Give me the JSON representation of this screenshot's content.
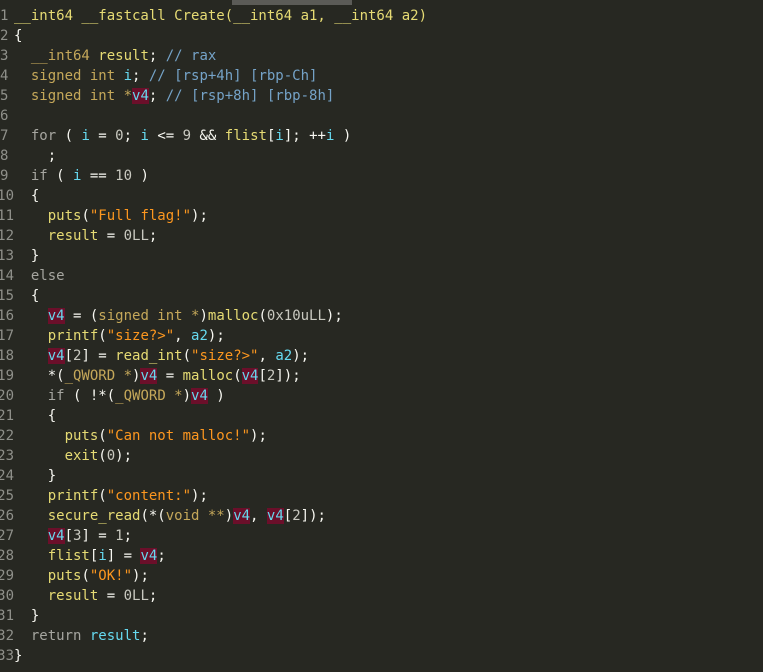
{
  "window": {
    "scroll_fraction": 0.33
  },
  "code": {
    "lines": [
      {
        "n": "1",
        "tokens": [
          {
            "t": "__int64 __fastcall Create(__int64 a1, __int64 a2)",
            "c": "fn"
          }
        ]
      },
      {
        "n": "2",
        "tokens": [
          {
            "t": "{",
            "c": "op"
          }
        ]
      },
      {
        "n": "3",
        "tokens": [
          {
            "t": "  __int64 ",
            "c": "ty"
          },
          {
            "t": "result",
            "c": "fn"
          },
          {
            "t": "; ",
            "c": "op"
          },
          {
            "t": "// rax",
            "c": "cm"
          }
        ]
      },
      {
        "n": "4",
        "tokens": [
          {
            "t": "  signed int ",
            "c": "ty"
          },
          {
            "t": "i",
            "c": "var"
          },
          {
            "t": "; ",
            "c": "op"
          },
          {
            "t": "// [rsp+4h] [rbp-Ch]",
            "c": "cm"
          }
        ]
      },
      {
        "n": "5",
        "tokens": [
          {
            "t": "  signed int *",
            "c": "ty"
          },
          {
            "t": "v4",
            "c": "hl"
          },
          {
            "t": "; ",
            "c": "op"
          },
          {
            "t": "// [rsp+8h] [rbp-8h]",
            "c": "cm"
          }
        ]
      },
      {
        "n": "6",
        "tokens": [
          {
            "t": "",
            "c": "op"
          }
        ]
      },
      {
        "n": "7",
        "tokens": [
          {
            "t": "  for ",
            "c": "kw"
          },
          {
            "t": "( ",
            "c": "op"
          },
          {
            "t": "i",
            "c": "var"
          },
          {
            "t": " = ",
            "c": "op"
          },
          {
            "t": "0",
            "c": "num"
          },
          {
            "t": "; ",
            "c": "op"
          },
          {
            "t": "i",
            "c": "var"
          },
          {
            "t": " <= ",
            "c": "op"
          },
          {
            "t": "9",
            "c": "num"
          },
          {
            "t": " && ",
            "c": "op"
          },
          {
            "t": "flist",
            "c": "fn"
          },
          {
            "t": "[",
            "c": "op"
          },
          {
            "t": "i",
            "c": "var"
          },
          {
            "t": "]; ++",
            "c": "op"
          },
          {
            "t": "i",
            "c": "var"
          },
          {
            "t": " )",
            "c": "op"
          }
        ]
      },
      {
        "n": "8",
        "tokens": [
          {
            "t": "    ;",
            "c": "op"
          }
        ]
      },
      {
        "n": "9",
        "tokens": [
          {
            "t": "  if ",
            "c": "kw"
          },
          {
            "t": "( ",
            "c": "op"
          },
          {
            "t": "i",
            "c": "var"
          },
          {
            "t": " == ",
            "c": "op"
          },
          {
            "t": "10",
            "c": "num"
          },
          {
            "t": " )",
            "c": "op"
          }
        ]
      },
      {
        "n": "10",
        "tokens": [
          {
            "t": "  {",
            "c": "op"
          }
        ]
      },
      {
        "n": "11",
        "tokens": [
          {
            "t": "    ",
            "c": "op"
          },
          {
            "t": "puts",
            "c": "fn"
          },
          {
            "t": "(",
            "c": "op"
          },
          {
            "t": "\"Full flag!\"",
            "c": "str"
          },
          {
            "t": ");",
            "c": "op"
          }
        ]
      },
      {
        "n": "12",
        "tokens": [
          {
            "t": "    ",
            "c": "op"
          },
          {
            "t": "result",
            "c": "fn"
          },
          {
            "t": " = ",
            "c": "op"
          },
          {
            "t": "0LL",
            "c": "num"
          },
          {
            "t": ";",
            "c": "op"
          }
        ]
      },
      {
        "n": "13",
        "tokens": [
          {
            "t": "  }",
            "c": "op"
          }
        ]
      },
      {
        "n": "14",
        "tokens": [
          {
            "t": "  else",
            "c": "kw"
          }
        ]
      },
      {
        "n": "15",
        "tokens": [
          {
            "t": "  {",
            "c": "op"
          }
        ]
      },
      {
        "n": "16",
        "tokens": [
          {
            "t": "    ",
            "c": "op"
          },
          {
            "t": "v4",
            "c": "hl"
          },
          {
            "t": " = (",
            "c": "op"
          },
          {
            "t": "signed int *",
            "c": "ty"
          },
          {
            "t": ")",
            "c": "op"
          },
          {
            "t": "malloc",
            "c": "fn"
          },
          {
            "t": "(",
            "c": "op"
          },
          {
            "t": "0x10uLL",
            "c": "num"
          },
          {
            "t": ");",
            "c": "op"
          }
        ]
      },
      {
        "n": "17",
        "tokens": [
          {
            "t": "    ",
            "c": "op"
          },
          {
            "t": "printf",
            "c": "fn"
          },
          {
            "t": "(",
            "c": "op"
          },
          {
            "t": "\"size?>\"",
            "c": "str"
          },
          {
            "t": ", ",
            "c": "op"
          },
          {
            "t": "a2",
            "c": "var"
          },
          {
            "t": ");",
            "c": "op"
          }
        ]
      },
      {
        "n": "18",
        "tokens": [
          {
            "t": "    ",
            "c": "op"
          },
          {
            "t": "v4",
            "c": "hl"
          },
          {
            "t": "[",
            "c": "op"
          },
          {
            "t": "2",
            "c": "num"
          },
          {
            "t": "] = ",
            "c": "op"
          },
          {
            "t": "read_int",
            "c": "fn"
          },
          {
            "t": "(",
            "c": "op"
          },
          {
            "t": "\"size?>\"",
            "c": "str"
          },
          {
            "t": ", ",
            "c": "op"
          },
          {
            "t": "a2",
            "c": "var"
          },
          {
            "t": ");",
            "c": "op"
          }
        ]
      },
      {
        "n": "19",
        "tokens": [
          {
            "t": "    *(",
            "c": "op"
          },
          {
            "t": "_QWORD *",
            "c": "ty"
          },
          {
            "t": ")",
            "c": "op"
          },
          {
            "t": "v4",
            "c": "hl"
          },
          {
            "t": " = ",
            "c": "op"
          },
          {
            "t": "malloc",
            "c": "fn"
          },
          {
            "t": "(",
            "c": "op"
          },
          {
            "t": "v4",
            "c": "hl"
          },
          {
            "t": "[",
            "c": "op"
          },
          {
            "t": "2",
            "c": "num"
          },
          {
            "t": "]);",
            "c": "op"
          }
        ]
      },
      {
        "n": "20",
        "tokens": [
          {
            "t": "    if ",
            "c": "kw"
          },
          {
            "t": "( !*(",
            "c": "op"
          },
          {
            "t": "_QWORD *",
            "c": "ty"
          },
          {
            "t": ")",
            "c": "op"
          },
          {
            "t": "v4",
            "c": "hl"
          },
          {
            "t": " )",
            "c": "op"
          }
        ]
      },
      {
        "n": "21",
        "tokens": [
          {
            "t": "    {",
            "c": "op"
          }
        ]
      },
      {
        "n": "22",
        "tokens": [
          {
            "t": "      ",
            "c": "op"
          },
          {
            "t": "puts",
            "c": "fn"
          },
          {
            "t": "(",
            "c": "op"
          },
          {
            "t": "\"Can not malloc!\"",
            "c": "str"
          },
          {
            "t": ");",
            "c": "op"
          }
        ]
      },
      {
        "n": "23",
        "tokens": [
          {
            "t": "      ",
            "c": "op"
          },
          {
            "t": "exit",
            "c": "fn"
          },
          {
            "t": "(",
            "c": "op"
          },
          {
            "t": "0",
            "c": "num"
          },
          {
            "t": ");",
            "c": "op"
          }
        ]
      },
      {
        "n": "24",
        "tokens": [
          {
            "t": "    }",
            "c": "op"
          }
        ]
      },
      {
        "n": "25",
        "tokens": [
          {
            "t": "    ",
            "c": "op"
          },
          {
            "t": "printf",
            "c": "fn"
          },
          {
            "t": "(",
            "c": "op"
          },
          {
            "t": "\"content:\"",
            "c": "str"
          },
          {
            "t": ");",
            "c": "op"
          }
        ]
      },
      {
        "n": "26",
        "tokens": [
          {
            "t": "    ",
            "c": "op"
          },
          {
            "t": "secure_read",
            "c": "fn"
          },
          {
            "t": "(*(",
            "c": "op"
          },
          {
            "t": "void **",
            "c": "ty"
          },
          {
            "t": ")",
            "c": "op"
          },
          {
            "t": "v4",
            "c": "hl"
          },
          {
            "t": ", ",
            "c": "op"
          },
          {
            "t": "v4",
            "c": "hl"
          },
          {
            "t": "[",
            "c": "op"
          },
          {
            "t": "2",
            "c": "num"
          },
          {
            "t": "]);",
            "c": "op"
          }
        ]
      },
      {
        "n": "27",
        "tokens": [
          {
            "t": "    ",
            "c": "op"
          },
          {
            "t": "v4",
            "c": "hl"
          },
          {
            "t": "[",
            "c": "op"
          },
          {
            "t": "3",
            "c": "num"
          },
          {
            "t": "] = ",
            "c": "op"
          },
          {
            "t": "1",
            "c": "num"
          },
          {
            "t": ";",
            "c": "op"
          }
        ]
      },
      {
        "n": "28",
        "tokens": [
          {
            "t": "    ",
            "c": "op"
          },
          {
            "t": "flist",
            "c": "fn"
          },
          {
            "t": "[",
            "c": "op"
          },
          {
            "t": "i",
            "c": "var"
          },
          {
            "t": "] = ",
            "c": "op"
          },
          {
            "t": "v4",
            "c": "hl"
          },
          {
            "t": ";",
            "c": "op"
          }
        ]
      },
      {
        "n": "29",
        "tokens": [
          {
            "t": "    ",
            "c": "op"
          },
          {
            "t": "puts",
            "c": "fn"
          },
          {
            "t": "(",
            "c": "op"
          },
          {
            "t": "\"OK!\"",
            "c": "str"
          },
          {
            "t": ");",
            "c": "op"
          }
        ]
      },
      {
        "n": "30",
        "tokens": [
          {
            "t": "    ",
            "c": "op"
          },
          {
            "t": "result",
            "c": "fn"
          },
          {
            "t": " = ",
            "c": "op"
          },
          {
            "t": "0LL",
            "c": "num"
          },
          {
            "t": ";",
            "c": "op"
          }
        ]
      },
      {
        "n": "31",
        "tokens": [
          {
            "t": "  }",
            "c": "op"
          }
        ]
      },
      {
        "n": "32",
        "tokens": [
          {
            "t": "  return ",
            "c": "kw"
          },
          {
            "t": "result",
            "c": "var"
          },
          {
            "t": ";",
            "c": "op"
          }
        ]
      },
      {
        "n": "33",
        "tokens": [
          {
            "t": "}",
            "c": "op"
          }
        ]
      }
    ]
  }
}
